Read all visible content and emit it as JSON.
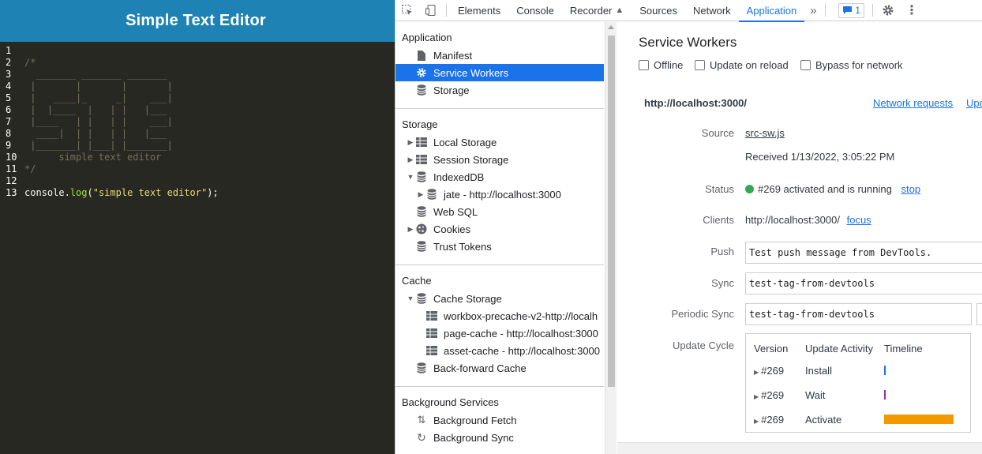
{
  "app": {
    "title": "Simple Text Editor",
    "code_lines": [
      {
        "n": "1",
        "parts": []
      },
      {
        "n": "2",
        "parts": [
          {
            "t": "/*",
            "c": "cm"
          }
        ]
      },
      {
        "n": "3",
        "parts": [
          {
            "t": "  _______ _______ _______ ",
            "c": "cm"
          }
        ]
      },
      {
        "n": "4",
        "parts": [
          {
            "t": " |       |       |       |",
            "c": "cm"
          }
        ]
      },
      {
        "n": "5",
        "parts": [
          {
            "t": " |   ____|_     _|    ___|",
            "c": "cm"
          }
        ]
      },
      {
        "n": "6",
        "parts": [
          {
            "t": " |  |____  |   | |   |___ ",
            "c": "cm"
          }
        ]
      },
      {
        "n": "7",
        "parts": [
          {
            "t": " |____   | |   | |    ___|",
            "c": "cm"
          }
        ]
      },
      {
        "n": "8",
        "parts": [
          {
            "t": "  ____|  | |   | |   |___ ",
            "c": "cm"
          }
        ]
      },
      {
        "n": "9",
        "parts": [
          {
            "t": " |_______| |___| |_______|",
            "c": "cm"
          }
        ]
      },
      {
        "n": "10",
        "parts": [
          {
            "t": "      simple text editor",
            "c": "cm"
          }
        ]
      },
      {
        "n": "11",
        "parts": [
          {
            "t": "*/",
            "c": "cm"
          }
        ]
      },
      {
        "n": "12",
        "parts": []
      },
      {
        "n": "13",
        "parts": [
          {
            "t": "console",
            "c": "op"
          },
          {
            "t": ".",
            "c": "op"
          },
          {
            "t": "log",
            "c": "fn"
          },
          {
            "t": "(",
            "c": "op"
          },
          {
            "t": "\"simple text editor\"",
            "c": "st"
          },
          {
            "t": ");",
            "c": "op"
          }
        ]
      }
    ]
  },
  "devtools": {
    "tabs": [
      "Elements",
      "Console",
      "Recorder",
      "Sources",
      "Network",
      "Application"
    ],
    "active_tab": "Application",
    "issue_count": "1",
    "sidebar": {
      "application_header": "Application",
      "application_items": [
        "Manifest",
        "Service Workers",
        "Storage"
      ],
      "storage_header": "Storage",
      "storage_items": [
        "Local Storage",
        "Session Storage",
        "IndexedDB",
        "jate - http://localhost:3000",
        "Web SQL",
        "Cookies",
        "Trust Tokens"
      ],
      "cache_header": "Cache",
      "cache_items": [
        "Cache Storage",
        "workbox-precache-v2-http://localh",
        "page-cache - http://localhost:3000",
        "asset-cache - http://localhost:3000",
        "Back-forward Cache"
      ],
      "bg_header": "Background Services",
      "bg_items": [
        "Background Fetch",
        "Background Sync"
      ]
    },
    "sw": {
      "title": "Service Workers",
      "offline": "Offline",
      "update_on_reload": "Update on reload",
      "bypass": "Bypass for network",
      "origin": "http://localhost:3000/",
      "network_requests": "Network requests",
      "update_link": "Update",
      "source_label": "Source",
      "source_link": "src-sw.js",
      "received": "Received 1/13/2022, 3:05:22 PM",
      "status_label": "Status",
      "status_text": "#269 activated and is running",
      "stop_link": "stop",
      "clients_label": "Clients",
      "clients_value": "http://localhost:3000/",
      "focus_link": "focus",
      "push_label": "Push",
      "push_value": "Test push message from DevTools.",
      "sync_label": "Sync",
      "sync_value": "test-tag-from-devtools",
      "periodic_label": "Periodic Sync",
      "periodic_value": "test-tag-from-devtools",
      "update_cycle_label": "Update Cycle",
      "uc_headers": [
        "Version",
        "Update Activity",
        "Timeline"
      ],
      "uc_rows": [
        {
          "version": "#269",
          "activity": "Install"
        },
        {
          "version": "#269",
          "activity": "Wait"
        },
        {
          "version": "#269",
          "activity": "Activate"
        }
      ],
      "colors": {
        "install": "#1a73e8",
        "wait": "#9c27b0",
        "activate": "#f29900",
        "status": "#34a853"
      }
    }
  }
}
